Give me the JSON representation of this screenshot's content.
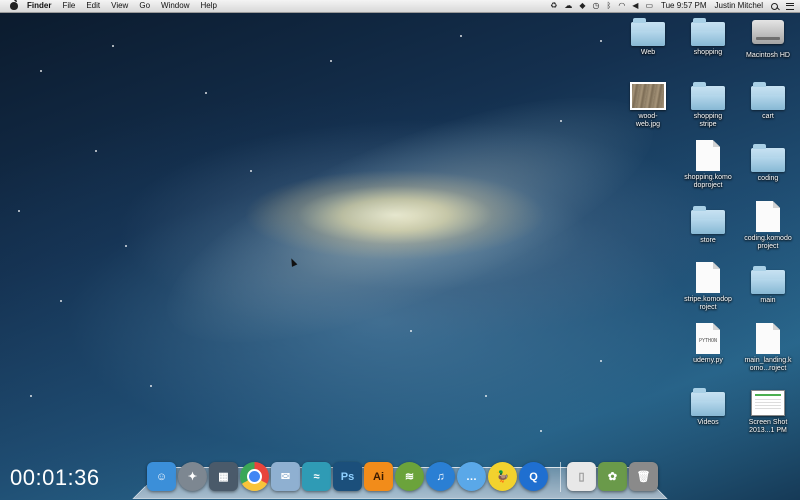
{
  "menubar": {
    "app_name": "Finder",
    "menus": [
      "File",
      "Edit",
      "View",
      "Go",
      "Window",
      "Help"
    ],
    "status": {
      "clock": "Tue 9:57 PM",
      "user": "Justin Mitchel"
    }
  },
  "desktop_icons": [
    {
      "label": "Web",
      "kind": "folder"
    },
    {
      "label": "shopping",
      "kind": "folder"
    },
    {
      "label": "Macintosh HD",
      "kind": "drive"
    },
    {
      "label": "wood-web.jpg",
      "kind": "image"
    },
    {
      "label": "shopping stripe",
      "kind": "folder"
    },
    {
      "label": "cart",
      "kind": "folder"
    },
    {
      "label": "shopping.komodoproject",
      "kind": "document"
    },
    {
      "label": "coding",
      "kind": "folder"
    },
    {
      "label": "store",
      "kind": "folder"
    },
    {
      "label": "coding.komodoproject",
      "kind": "document"
    },
    {
      "label": "stripe.komodoproject",
      "kind": "document"
    },
    {
      "label": "main",
      "kind": "folder"
    },
    {
      "label": "udemy.py",
      "kind": "python",
      "tag": "PYTHON"
    },
    {
      "label": "main_landing.komo...roject",
      "kind": "document"
    },
    {
      "label": "Videos",
      "kind": "folder"
    },
    {
      "label": "Screen Shot 2013...1 PM",
      "kind": "screenshot"
    }
  ],
  "dock": {
    "apps": [
      {
        "name": "finder",
        "glyph": "☺",
        "color": "#3b8fd9"
      },
      {
        "name": "launchpad",
        "glyph": "✦",
        "color": "#7d8791"
      },
      {
        "name": "mission-control",
        "glyph": "▦",
        "color": "#4a5a6a"
      },
      {
        "name": "chrome",
        "glyph": "",
        "color": "#e8453c"
      },
      {
        "name": "preview",
        "glyph": "✉",
        "color": "#8fb0d1"
      },
      {
        "name": "dashcode",
        "glyph": "≈",
        "color": "#2f9bb5"
      },
      {
        "name": "photoshop",
        "glyph": "Ps",
        "color": "#1b4f7b"
      },
      {
        "name": "illustrator",
        "glyph": "Ai",
        "color": "#f28c1a"
      },
      {
        "name": "spotify",
        "glyph": "≋",
        "color": "#6ba33b"
      },
      {
        "name": "itunes",
        "glyph": "♫",
        "color": "#2a7fd4"
      },
      {
        "name": "messages",
        "glyph": "…",
        "color": "#5aa8e8"
      },
      {
        "name": "cyberduck",
        "glyph": "🦆",
        "color": "#f2d22e"
      },
      {
        "name": "quicktime",
        "glyph": "Q",
        "color": "#1f6fd0"
      }
    ],
    "extras": [
      {
        "name": "documents-stack",
        "glyph": "▯",
        "color": "#e8e8e8"
      },
      {
        "name": "downloads-stack",
        "glyph": "✿",
        "color": "#6a9a4a"
      },
      {
        "name": "trash",
        "glyph": "🗑",
        "color": "#8a8a8a"
      }
    ]
  },
  "recording_timer": "00:01:36"
}
